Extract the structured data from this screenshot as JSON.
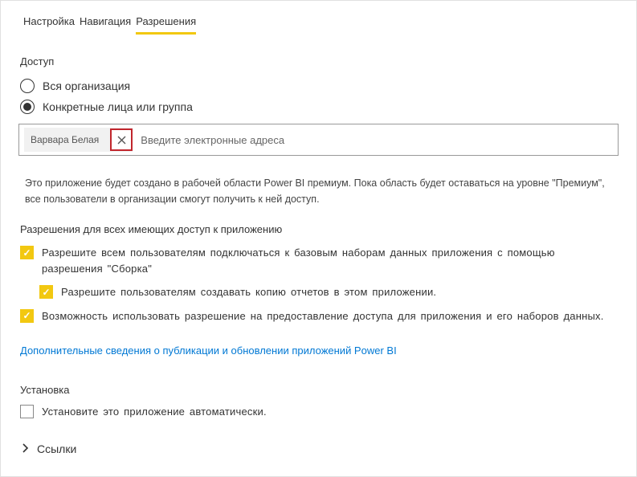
{
  "tabs": {
    "setup": "Настройка",
    "navigation": "Навигация",
    "permissions": "Разрешения"
  },
  "access": {
    "heading": "Доступ",
    "entire_org": "Вся организация",
    "specific": "Конкретные лица или группа",
    "chip_name": "Варвара Белая",
    "input_placeholder": "Введите электронные адреса"
  },
  "info": "Это приложение будет создано в рабочей области Power BI премиум. Пока область будет оставаться на уровне \"Премиум\", все пользователи в организации смогут получить к ней доступ.",
  "permissions": {
    "heading": "Разрешения для всех имеющих доступ к приложению",
    "perm1": "Разрешите всем пользователям подключаться к базовым наборам данных приложения с помощью разрешения \"Сборка\"",
    "perm2": "Разрешите пользователям создавать копию отчетов в этом приложении.",
    "perm3": "Возможность использовать разрешение на предоставление доступа для приложения и его наборов данных."
  },
  "link": "Дополнительные сведения о публикации и обновлении приложений Power BI",
  "install": {
    "heading": "Установка",
    "auto": "Установите это приложение автоматически."
  },
  "links_section": "Ссылки"
}
